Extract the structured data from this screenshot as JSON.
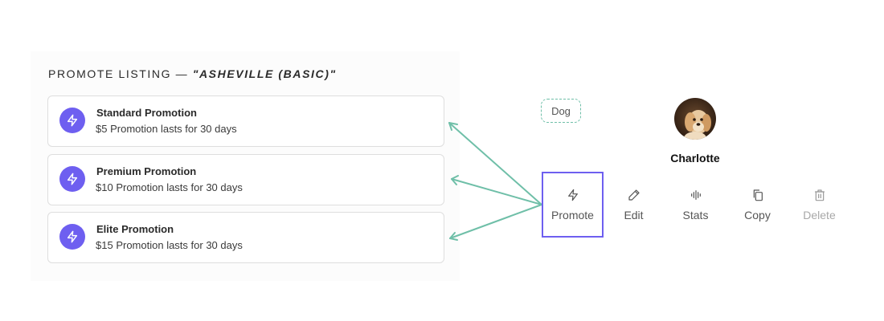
{
  "panel": {
    "title_prefix": "Promote Listing —",
    "listing_name": "\"Asheville (Basic)\"",
    "promotions": [
      {
        "name": "Standard Promotion",
        "price": "$5",
        "duration": "Promotion lasts for 30 days",
        "icon": "bolt-icon"
      },
      {
        "name": "Premium Promotion",
        "price": "$10",
        "duration": "Promotion lasts for 30 days",
        "icon": "bolt-icon"
      },
      {
        "name": "Elite Promotion",
        "price": "$15",
        "duration": "Promotion lasts for 30 days",
        "icon": "bolt-icon"
      }
    ]
  },
  "tag": {
    "label": "Dog"
  },
  "profile": {
    "name": "Charlotte",
    "avatar": "dog-avatar"
  },
  "actions": [
    {
      "label": "Promote",
      "icon": "bolt-icon",
      "selected": true
    },
    {
      "label": "Edit",
      "icon": "pencil-icon"
    },
    {
      "label": "Stats",
      "icon": "stats-icon"
    },
    {
      "label": "Copy",
      "icon": "copy-icon"
    },
    {
      "label": "Delete",
      "icon": "trash-icon",
      "disabled": true
    }
  ],
  "colors": {
    "accent": "#6e5ff0",
    "arrow": "#6fbfa8",
    "disabled": "#a8a8a8"
  }
}
